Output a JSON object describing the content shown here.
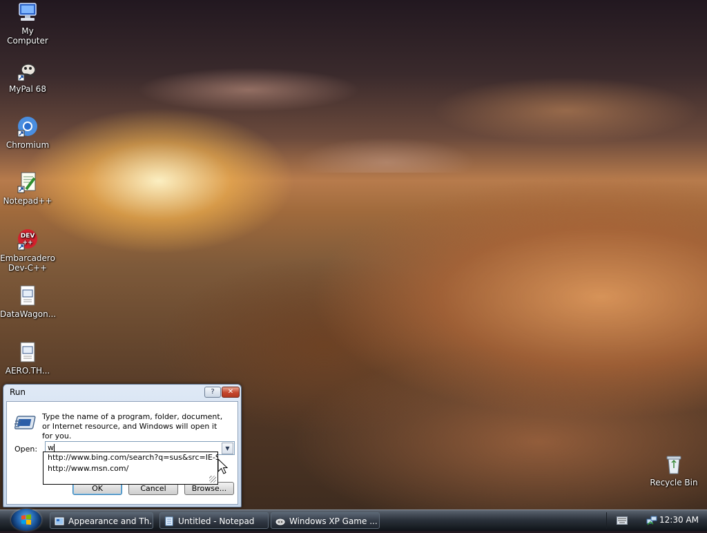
{
  "desktop_icons": [
    {
      "label": "My Computer"
    },
    {
      "label": "MyPal 68"
    },
    {
      "label": "Chromium"
    },
    {
      "label": "Notepad++"
    },
    {
      "label": "Embarcadero\nDev-C++"
    },
    {
      "label": "DataWagon..."
    },
    {
      "label": "AERO.TH..."
    },
    {
      "label": "Recycle Bin"
    }
  ],
  "run_dialog": {
    "title": "Run",
    "help_btn": "?",
    "close_btn": "✕",
    "description": "Type the name of a program, folder, document, or Internet resource, and Windows will open it for you.",
    "open_label": "Open:",
    "open_value": "w",
    "dropdown_arrow": "▼",
    "ok_label": "OK",
    "cancel_label": "Cancel",
    "browse_label": "Browse...",
    "suggestions": [
      "http://www.bing.com/search?q=sus&src=IE-S",
      "http://www.msn.com/"
    ]
  },
  "taskbar": {
    "items": [
      {
        "label": "Appearance and Th..."
      },
      {
        "label": "Untitled - Notepad"
      },
      {
        "label": "Windows XP Game ..."
      }
    ],
    "clock": "12:30 AM"
  }
}
